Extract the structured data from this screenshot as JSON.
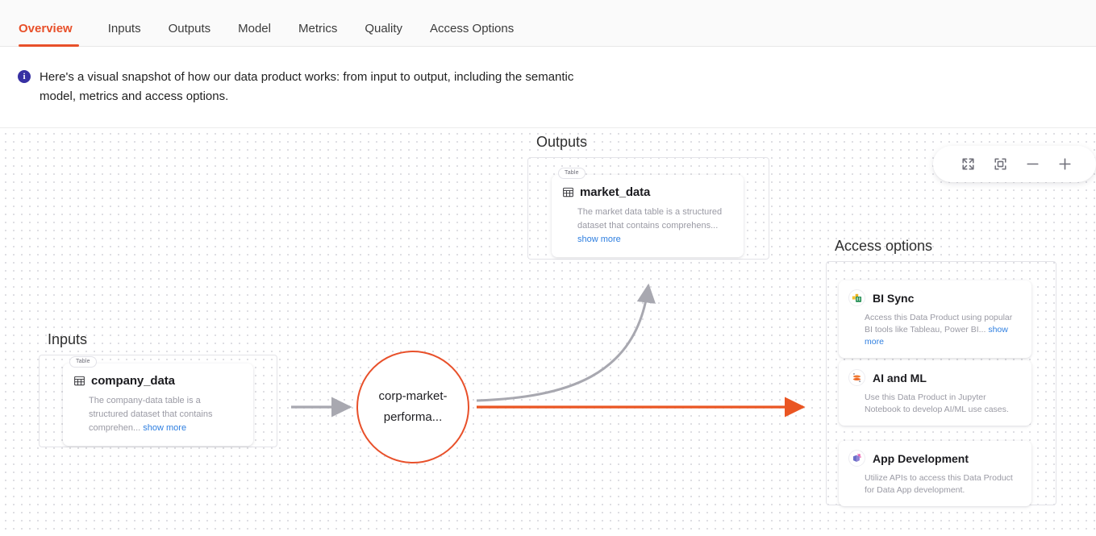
{
  "tabs": [
    {
      "label": "Overview",
      "active": true
    },
    {
      "label": "Inputs",
      "active": false
    },
    {
      "label": "Outputs",
      "active": false
    },
    {
      "label": "Model",
      "active": false
    },
    {
      "label": "Metrics",
      "active": false
    },
    {
      "label": "Quality",
      "active": false
    },
    {
      "label": "Access Options",
      "active": false
    }
  ],
  "banner": {
    "icon": "info-icon",
    "text": "Here's a visual snapshot of how our data product works: from input to output, including the semantic model, metrics and access options."
  },
  "canvas": {
    "groups": {
      "inputs_title": "Inputs",
      "outputs_title": "Outputs",
      "access_title": "Access options"
    },
    "nodes": {
      "company": {
        "badge": "Table",
        "icon": "table-icon",
        "title": "company_data",
        "description": "The company-data table is a structured dataset that contains comprehen...",
        "show_more": "show more"
      },
      "market": {
        "badge": "Table",
        "icon": "table-icon",
        "title": "market_data",
        "description": "The market data table is a structured dataset that contains comprehens...",
        "show_more": "show more"
      },
      "center": {
        "label": "corp-market-performa...",
        "color": "#e8502a"
      }
    },
    "access_options": [
      {
        "icon": "bi-sync-icon",
        "title": "BI Sync",
        "description": "Access this Data Product using popular BI tools like Tableau, Power BI...",
        "show_more": "show more"
      },
      {
        "icon": "ai-ml-jupyter-icon",
        "title": "AI and ML",
        "description": "Use this Data Product in Jupyter Notebook to develop AI/ML use cases.",
        "show_more": ""
      },
      {
        "icon": "app-development-icon",
        "title": "App Development",
        "description": "Utilize APIs to access this Data Product for Data App development.",
        "show_more": ""
      }
    ],
    "toolbar": [
      {
        "icon": "fullscreen-icon",
        "label": "Fullscreen"
      },
      {
        "icon": "fit-to-screen-icon",
        "label": "Fit to screen"
      },
      {
        "icon": "zoom-out-icon",
        "label": "Zoom out"
      },
      {
        "icon": "zoom-in-icon",
        "label": "Zoom in"
      }
    ],
    "edges": [
      {
        "name": "input-to-model-edge",
        "color": "#a8a8b0",
        "style": "straight"
      },
      {
        "name": "model-to-output-edge",
        "color": "#a8a8b0",
        "style": "curved"
      },
      {
        "name": "model-to-access-edge",
        "color": "#e8502a",
        "style": "straight"
      }
    ]
  },
  "colors": {
    "accent": "#e8502a",
    "edge_gray": "#a8a8b0",
    "link": "#2f7fe0",
    "info": "#3730a3"
  }
}
